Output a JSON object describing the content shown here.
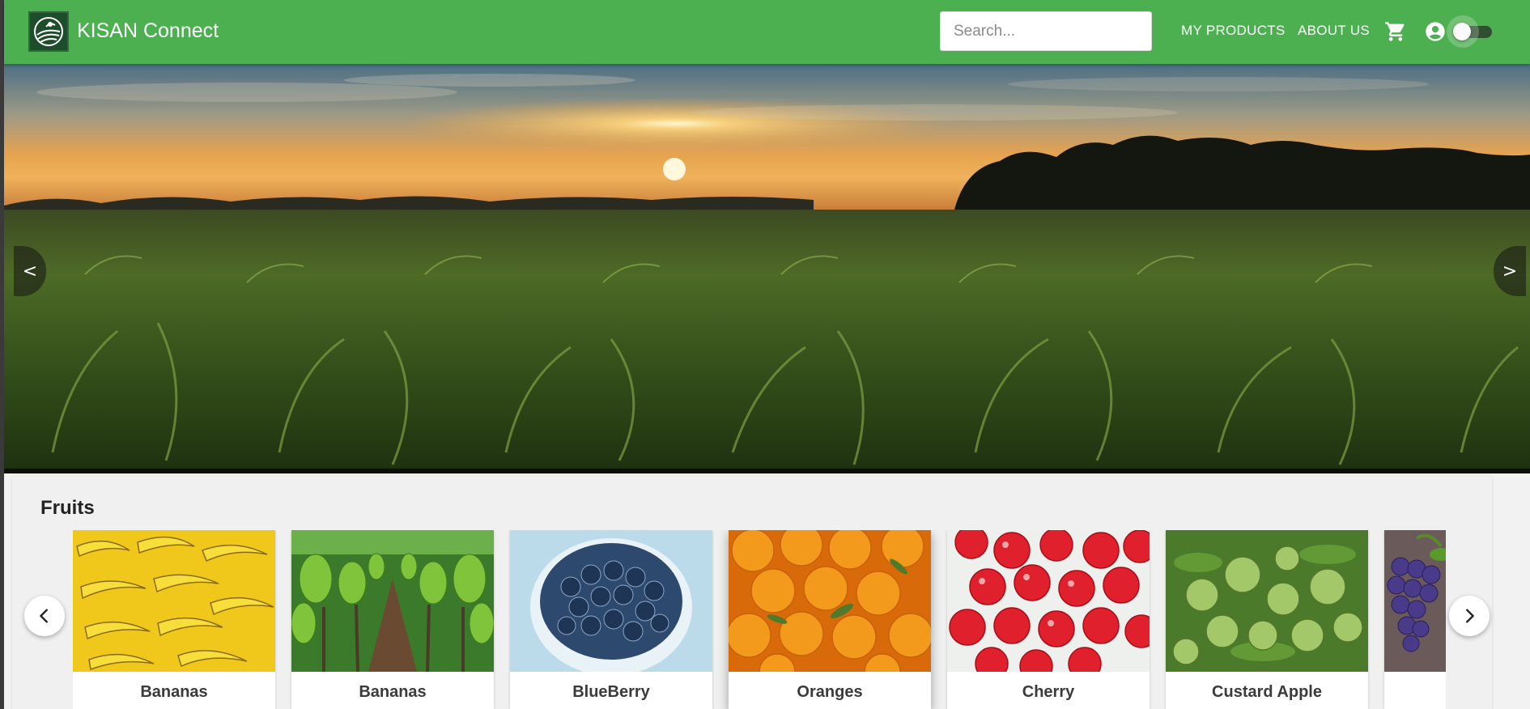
{
  "header": {
    "brand": "KISAN Connect",
    "search_placeholder": "Search...",
    "nav": [
      "MY PRODUCTS",
      "ABOUT US"
    ],
    "icons": [
      "cart-icon",
      "account-circle-icon"
    ],
    "theme_toggle_on": false,
    "color": "#4caf50"
  },
  "hero": {
    "prev_label": "<",
    "next_label": ">"
  },
  "section": {
    "title": "Fruits",
    "items": [
      {
        "name": "Bananas"
      },
      {
        "name": "Bananas"
      },
      {
        "name": "BlueBerry"
      },
      {
        "name": "Oranges"
      },
      {
        "name": "Cherry"
      },
      {
        "name": "Custard Apple"
      },
      {
        "name": ""
      }
    ]
  }
}
